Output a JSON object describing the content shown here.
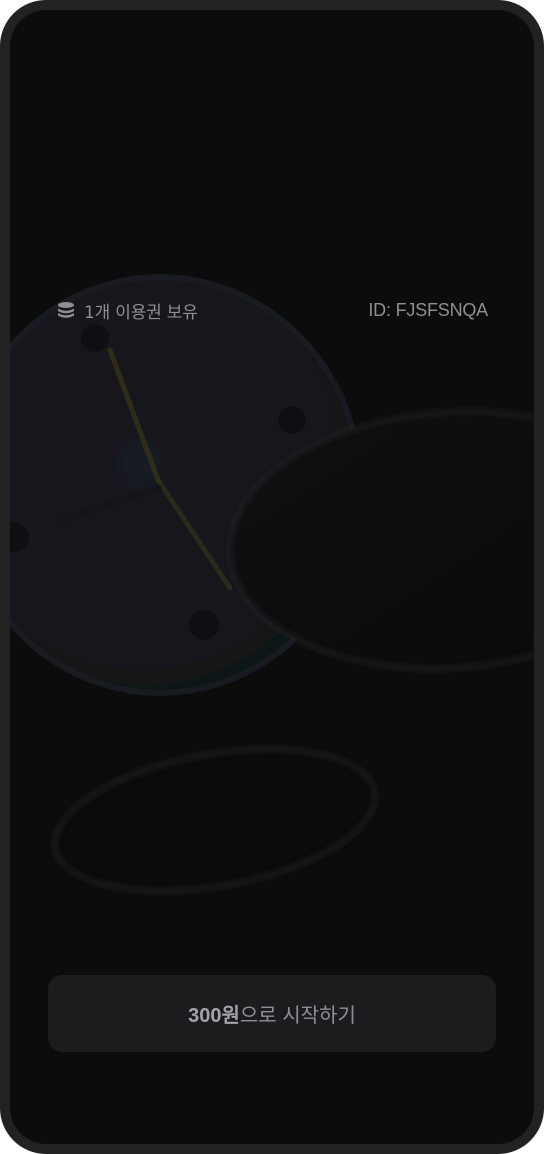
{
  "screen": {
    "ticket_count_text": "1개 이용권 보유",
    "user_id_text": "ID: FJSFSNQA"
  },
  "cta": {
    "price_text": "300원",
    "rest_text": "으로 시작하기"
  },
  "icons": {
    "ticket": "coin-stack-icon"
  },
  "colors": {
    "background": "#0c0c0d",
    "frame": "#222222",
    "button_bg": "#1c1c1e",
    "text_muted": "#8e8e93"
  }
}
